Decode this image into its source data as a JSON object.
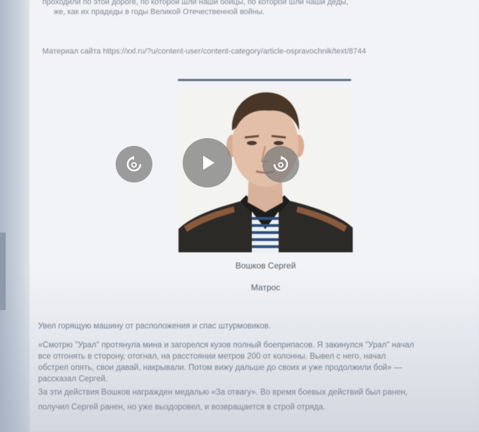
{
  "article": {
    "top_line_1": "проходили по этой дороге, по которой шли наши бойцы, по которой шли наши деды,",
    "top_line_2": "же, как их прадеды в годы Великой Отечественной войны.",
    "source_line": "Материал сайта https://xxl.ru/?u/content-user/content-category/article-ospravochnik/text/8744",
    "person_name": "Вошков Сергей",
    "person_role": "Матрос",
    "body_1": "Увел горящую машину от расположения и спас штурмовиков.",
    "body_2": "«Смотрю \"Урал\" протянула мина и загорелся кузов полный боеприпасов. Я закинулся \"Урал\" начал",
    "body_3": "все отгонять в сторону, отогнал, на расстоянии метров 200 от колонны. Вывел с него, начал",
    "body_4": "обстрел опять, свои давай, накрывали. Потом вижу дальше до своих и уже продолжили бой» —",
    "body_5": "рассказал Сергей.",
    "body_6": "За эти действия Вошков награжден медалью «За отвагу». Во время боевых действий был ранен,",
    "body_7": "получил Сергей ранен, но уже выздоровел, и возвращается в строй отряда."
  },
  "player": {
    "back_icon": "rewind-10-icon",
    "play_icon": "play-icon",
    "forward_icon": "forward-10-icon"
  },
  "colors": {
    "page_bg": "#f2f3f6",
    "text": "#7e8794",
    "divider": "#5e6f83",
    "control_bg": "#787878"
  }
}
